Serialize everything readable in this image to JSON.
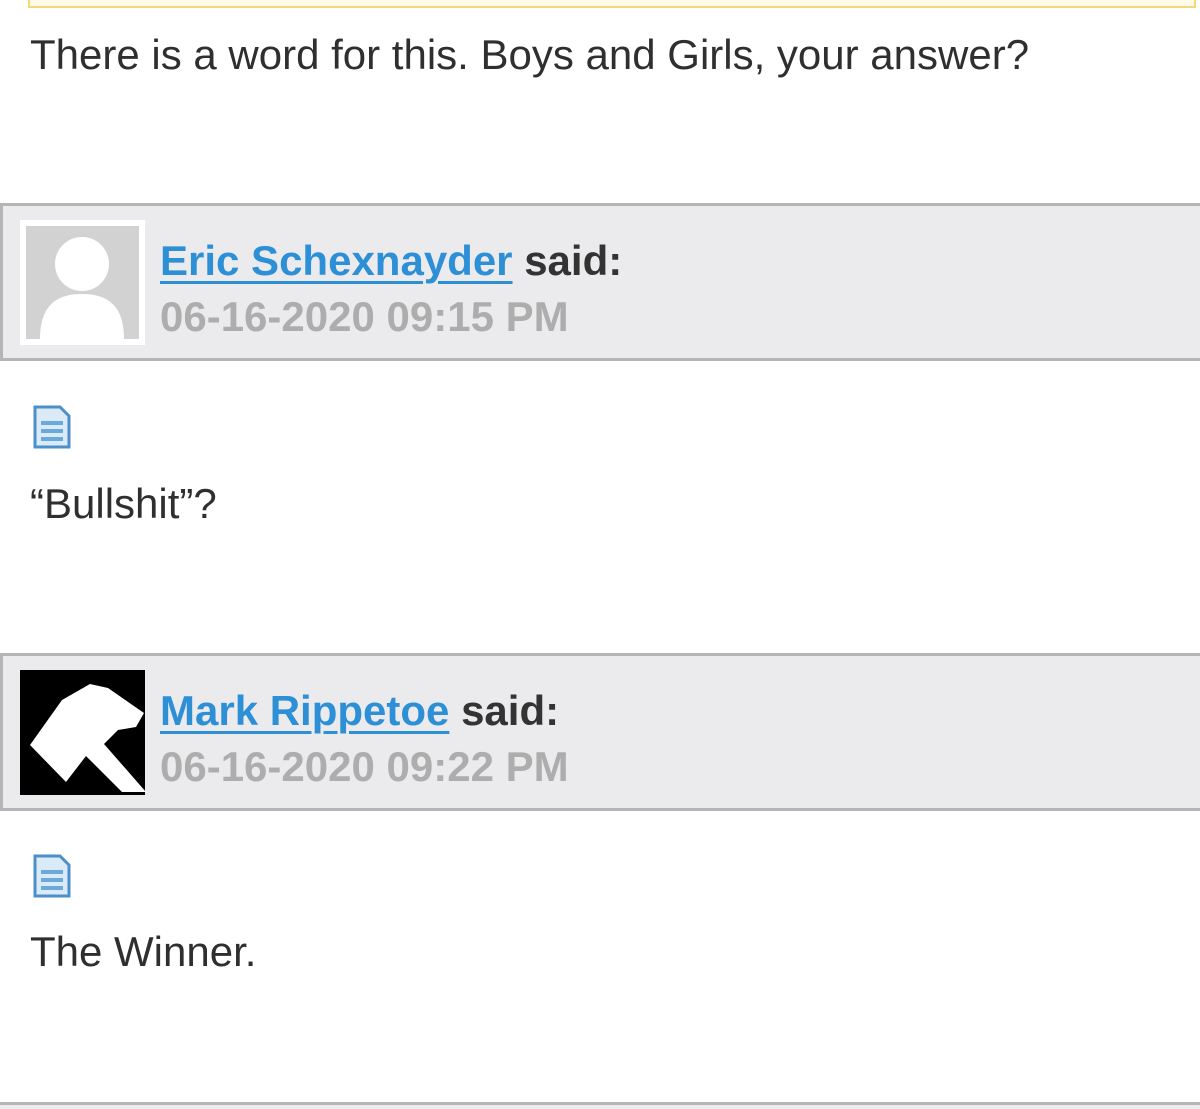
{
  "intro": {
    "text": "There is a word for this. Boys and Girls, your answer?"
  },
  "posts": [
    {
      "author": "Eric Schexnayder",
      "said": "said:",
      "timestamp": "06-16-2020 09:15 PM",
      "avatar": "default-user-avatar",
      "message_icon": "document-icon",
      "body": "“Bullshit”?"
    },
    {
      "author": "Mark Rippetoe",
      "said": "said:",
      "timestamp": "06-16-2020 09:22 PM",
      "avatar": "hammer-avatar",
      "message_icon": "document-icon",
      "body": "The Winner."
    }
  ],
  "colors": {
    "link": "#2d8fd5",
    "header_bg": "#ebebee",
    "header_border": "#b5b5b8",
    "timestamp": "#adadad",
    "quote_border": "#f1d97a"
  }
}
